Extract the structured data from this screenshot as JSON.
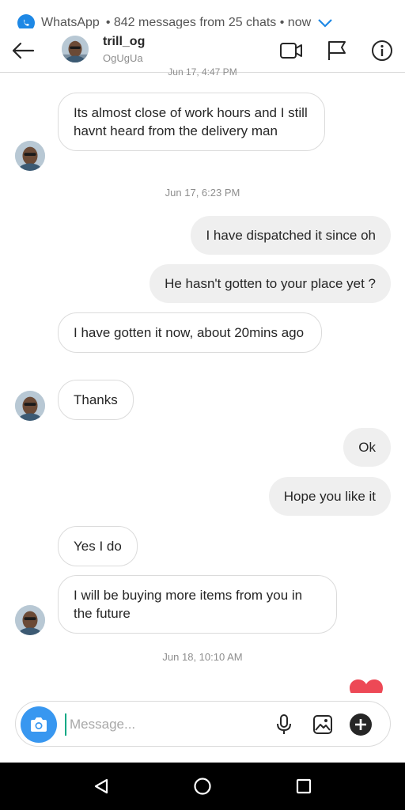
{
  "notification": {
    "app": "WhatsApp",
    "text": "• 842 messages from 25 chats • now"
  },
  "header": {
    "name": "trill_og",
    "username": "OgUgUa"
  },
  "timestamp_cut": "Jun 17, 4:47 PM",
  "messages": [
    {
      "text": "Its almost close of work hours and I still havnt heard from the delivery man"
    },
    {
      "timestamp": "Jun 17, 6:23 PM"
    },
    {
      "text": "I have dispatched it since oh"
    },
    {
      "text": "He hasn't gotten to your place yet ?"
    },
    {
      "text": "I have gotten it now, about 20mins ago"
    },
    {
      "text": "Thanks"
    },
    {
      "text": "Ok"
    },
    {
      "text": "Hope you like it"
    },
    {
      "text": "Yes I do"
    },
    {
      "text": "I will be buying more items from you in the future"
    },
    {
      "timestamp": "Jun 18, 10:10 AM"
    }
  ],
  "composer": {
    "placeholder": "Message..."
  },
  "icons": {
    "back": "arrow-left-icon",
    "video": "video-camera-icon",
    "flag": "flag-icon",
    "info": "info-icon",
    "camera": "camera-icon",
    "mic": "microphone-icon",
    "gallery": "image-icon",
    "add": "plus-circle-icon",
    "heart": "heart-icon"
  },
  "colors": {
    "accent": "#3897f0",
    "heart": "#ed4956",
    "outgoing_bubble": "#efefef"
  }
}
